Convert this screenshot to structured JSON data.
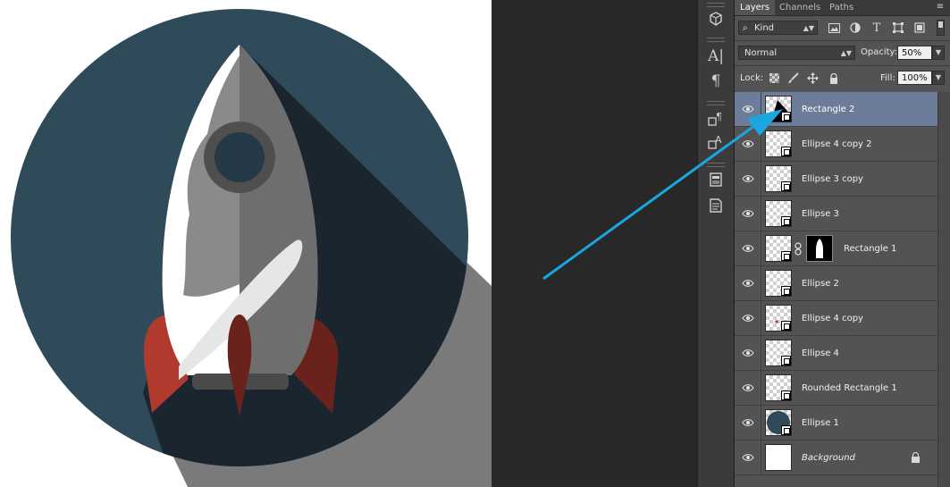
{
  "panel": {
    "tabs": [
      {
        "label": "Layers",
        "active": true
      },
      {
        "label": "Channels",
        "active": false
      },
      {
        "label": "Paths",
        "active": false
      }
    ],
    "filter": {
      "kind_label": "Kind",
      "icons": [
        "pixel-filter-icon",
        "adjustment-filter-icon",
        "type-filter-icon",
        "shape-filter-icon",
        "smart-object-filter-icon"
      ]
    },
    "blend_mode": "Normal",
    "opacity_label": "Opacity:",
    "opacity_value": "50%",
    "lock_label": "Lock:",
    "fill_label": "Fill:",
    "fill_value": "100%"
  },
  "toolstrip": {
    "icons": [
      "3d-icon",
      "character-icon",
      "paragraph-icon",
      "character-styles-icon",
      "paragraph-styles-icon",
      "notes-icon",
      "info-icon"
    ]
  },
  "layers": [
    {
      "name": "Rectangle 2",
      "selected": true,
      "type": "shape"
    },
    {
      "name": "Ellipse 4 copy 2",
      "selected": false,
      "type": "shape"
    },
    {
      "name": "Ellipse 3 copy",
      "selected": false,
      "type": "shape"
    },
    {
      "name": "Ellipse 3",
      "selected": false,
      "type": "shape"
    },
    {
      "name": "Rectangle 1",
      "selected": false,
      "type": "shape-with-mask"
    },
    {
      "name": "Ellipse 2",
      "selected": false,
      "type": "shape"
    },
    {
      "name": "Ellipse 4 copy",
      "selected": false,
      "type": "shape"
    },
    {
      "name": "Ellipse 4",
      "selected": false,
      "type": "shape"
    },
    {
      "name": "Rounded Rectangle 1",
      "selected": false,
      "type": "shape"
    },
    {
      "name": "Ellipse 1",
      "selected": false,
      "type": "shape"
    },
    {
      "name": "Background",
      "selected": false,
      "type": "background",
      "locked": true
    }
  ],
  "colors": {
    "circle": "#2f4b5a",
    "shadow": "#1a2530",
    "rocket_light": "#ffffff",
    "rocket_mid": "#848484",
    "rocket_dark": "#6b6b6b",
    "fin": "#b03a2e",
    "arrow": "#1aa7e0",
    "selection": "#6d7c99"
  }
}
